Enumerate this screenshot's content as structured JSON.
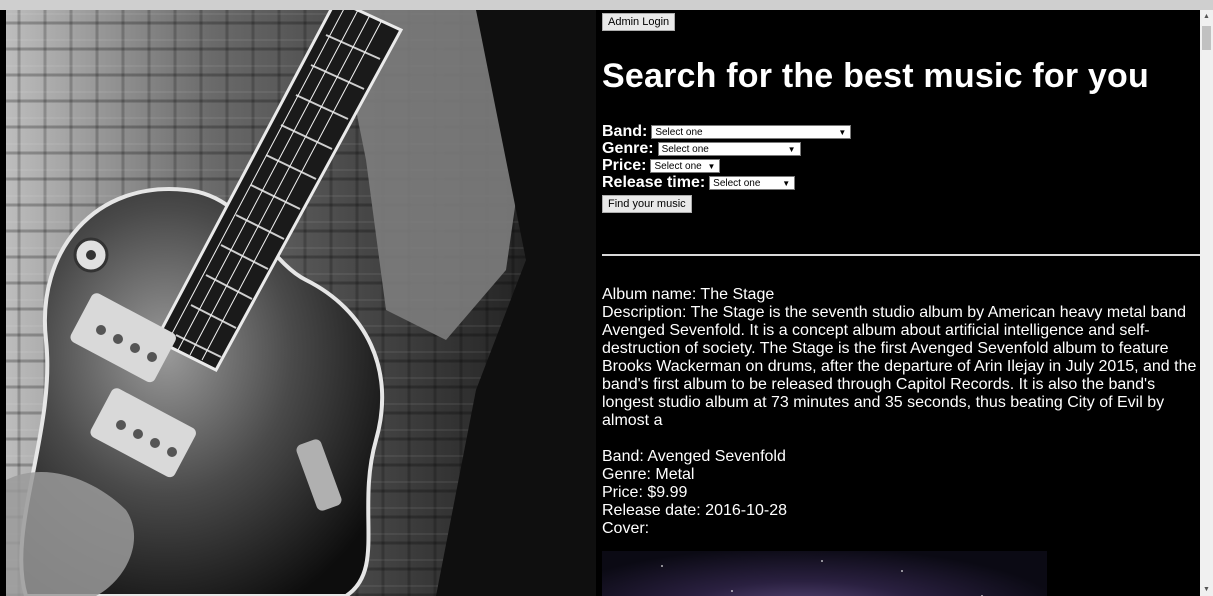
{
  "header": {
    "admin_login": "Admin Login",
    "title": "Search for the best music for you"
  },
  "filters": {
    "band": {
      "label": "Band:",
      "selected": "Select one"
    },
    "genre": {
      "label": "Genre:",
      "selected": "Select one"
    },
    "price": {
      "label": "Price:",
      "selected": "Select one"
    },
    "release_time": {
      "label": "Release time:",
      "selected": "Select one"
    },
    "find_button": "Find your music"
  },
  "album": {
    "name": "Album name: The Stage",
    "description": "Description: The Stage is the seventh studio album by American heavy metal band Avenged Sevenfold. It is a concept album about artificial intelligence and self-destruction of society. The Stage is the first Avenged Sevenfold album to feature Brooks Wackerman on drums, after the departure of Arin Ilejay in July 2015, and the band's first album to be released through Capitol Records. It is also the band's longest studio album at 73 minutes and 35 seconds, thus beating City of Evil by almost a",
    "band": "Band: Avenged Sevenfold",
    "genre": "Genre: Metal",
    "price": "Price: $9.99",
    "release_date": "Release date: 2016-10-28",
    "cover_label": "Cover:"
  },
  "icons": {
    "dropdown": "chevron-down-icon",
    "scroll_up": "arrow-up-icon",
    "scroll_down": "arrow-down-icon"
  },
  "colors": {
    "background": "#000000",
    "text": "#ffffff",
    "divider": "#d8d8d8"
  }
}
